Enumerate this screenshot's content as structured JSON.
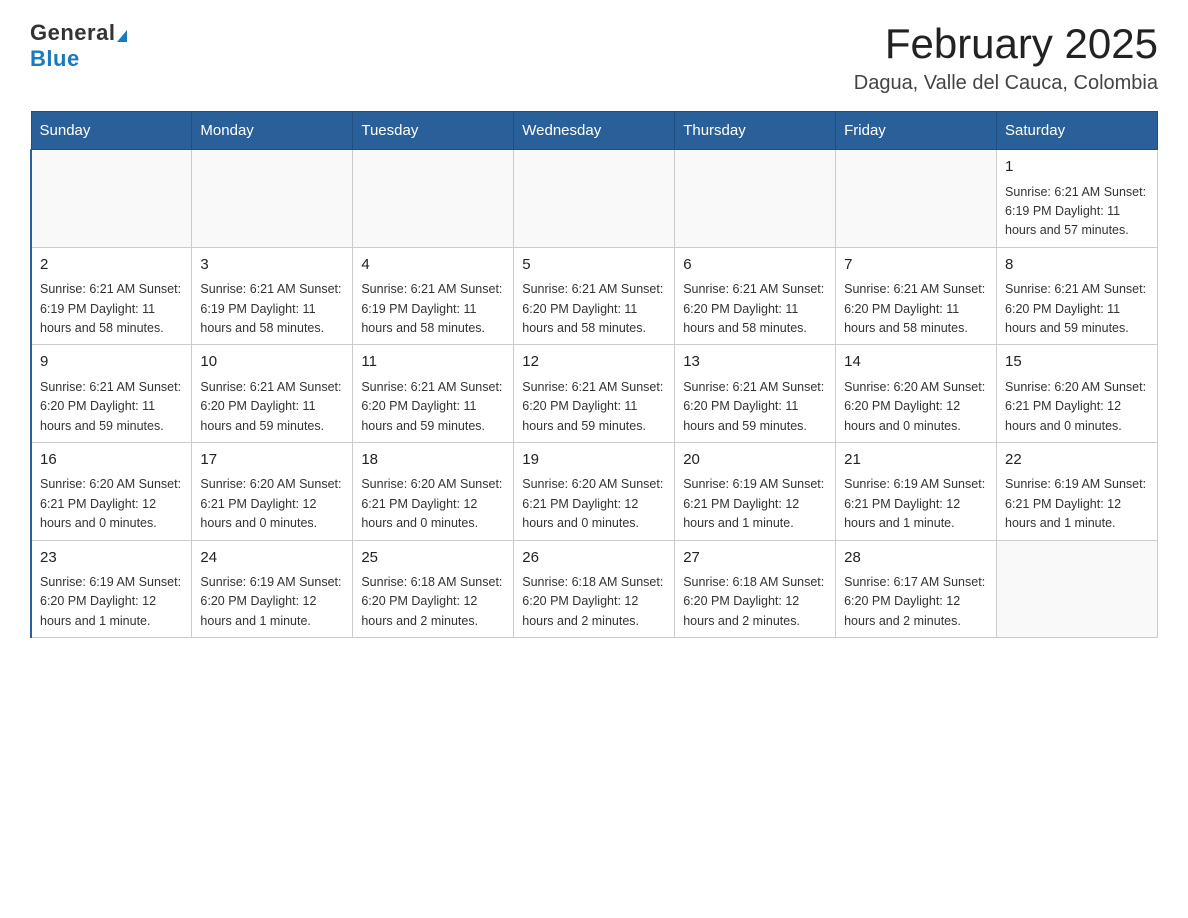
{
  "header": {
    "logo_general": "General",
    "logo_blue": "Blue",
    "main_title": "February 2025",
    "subtitle": "Dagua, Valle del Cauca, Colombia"
  },
  "calendar": {
    "days_of_week": [
      "Sunday",
      "Monday",
      "Tuesday",
      "Wednesday",
      "Thursday",
      "Friday",
      "Saturday"
    ],
    "weeks": [
      [
        {
          "day": "",
          "info": ""
        },
        {
          "day": "",
          "info": ""
        },
        {
          "day": "",
          "info": ""
        },
        {
          "day": "",
          "info": ""
        },
        {
          "day": "",
          "info": ""
        },
        {
          "day": "",
          "info": ""
        },
        {
          "day": "1",
          "info": "Sunrise: 6:21 AM\nSunset: 6:19 PM\nDaylight: 11 hours and 57 minutes."
        }
      ],
      [
        {
          "day": "2",
          "info": "Sunrise: 6:21 AM\nSunset: 6:19 PM\nDaylight: 11 hours and 58 minutes."
        },
        {
          "day": "3",
          "info": "Sunrise: 6:21 AM\nSunset: 6:19 PM\nDaylight: 11 hours and 58 minutes."
        },
        {
          "day": "4",
          "info": "Sunrise: 6:21 AM\nSunset: 6:19 PM\nDaylight: 11 hours and 58 minutes."
        },
        {
          "day": "5",
          "info": "Sunrise: 6:21 AM\nSunset: 6:20 PM\nDaylight: 11 hours and 58 minutes."
        },
        {
          "day": "6",
          "info": "Sunrise: 6:21 AM\nSunset: 6:20 PM\nDaylight: 11 hours and 58 minutes."
        },
        {
          "day": "7",
          "info": "Sunrise: 6:21 AM\nSunset: 6:20 PM\nDaylight: 11 hours and 58 minutes."
        },
        {
          "day": "8",
          "info": "Sunrise: 6:21 AM\nSunset: 6:20 PM\nDaylight: 11 hours and 59 minutes."
        }
      ],
      [
        {
          "day": "9",
          "info": "Sunrise: 6:21 AM\nSunset: 6:20 PM\nDaylight: 11 hours and 59 minutes."
        },
        {
          "day": "10",
          "info": "Sunrise: 6:21 AM\nSunset: 6:20 PM\nDaylight: 11 hours and 59 minutes."
        },
        {
          "day": "11",
          "info": "Sunrise: 6:21 AM\nSunset: 6:20 PM\nDaylight: 11 hours and 59 minutes."
        },
        {
          "day": "12",
          "info": "Sunrise: 6:21 AM\nSunset: 6:20 PM\nDaylight: 11 hours and 59 minutes."
        },
        {
          "day": "13",
          "info": "Sunrise: 6:21 AM\nSunset: 6:20 PM\nDaylight: 11 hours and 59 minutes."
        },
        {
          "day": "14",
          "info": "Sunrise: 6:20 AM\nSunset: 6:20 PM\nDaylight: 12 hours and 0 minutes."
        },
        {
          "day": "15",
          "info": "Sunrise: 6:20 AM\nSunset: 6:21 PM\nDaylight: 12 hours and 0 minutes."
        }
      ],
      [
        {
          "day": "16",
          "info": "Sunrise: 6:20 AM\nSunset: 6:21 PM\nDaylight: 12 hours and 0 minutes."
        },
        {
          "day": "17",
          "info": "Sunrise: 6:20 AM\nSunset: 6:21 PM\nDaylight: 12 hours and 0 minutes."
        },
        {
          "day": "18",
          "info": "Sunrise: 6:20 AM\nSunset: 6:21 PM\nDaylight: 12 hours and 0 minutes."
        },
        {
          "day": "19",
          "info": "Sunrise: 6:20 AM\nSunset: 6:21 PM\nDaylight: 12 hours and 0 minutes."
        },
        {
          "day": "20",
          "info": "Sunrise: 6:19 AM\nSunset: 6:21 PM\nDaylight: 12 hours and 1 minute."
        },
        {
          "day": "21",
          "info": "Sunrise: 6:19 AM\nSunset: 6:21 PM\nDaylight: 12 hours and 1 minute."
        },
        {
          "day": "22",
          "info": "Sunrise: 6:19 AM\nSunset: 6:21 PM\nDaylight: 12 hours and 1 minute."
        }
      ],
      [
        {
          "day": "23",
          "info": "Sunrise: 6:19 AM\nSunset: 6:20 PM\nDaylight: 12 hours and 1 minute."
        },
        {
          "day": "24",
          "info": "Sunrise: 6:19 AM\nSunset: 6:20 PM\nDaylight: 12 hours and 1 minute."
        },
        {
          "day": "25",
          "info": "Sunrise: 6:18 AM\nSunset: 6:20 PM\nDaylight: 12 hours and 2 minutes."
        },
        {
          "day": "26",
          "info": "Sunrise: 6:18 AM\nSunset: 6:20 PM\nDaylight: 12 hours and 2 minutes."
        },
        {
          "day": "27",
          "info": "Sunrise: 6:18 AM\nSunset: 6:20 PM\nDaylight: 12 hours and 2 minutes."
        },
        {
          "day": "28",
          "info": "Sunrise: 6:17 AM\nSunset: 6:20 PM\nDaylight: 12 hours and 2 minutes."
        },
        {
          "day": "",
          "info": ""
        }
      ]
    ]
  }
}
